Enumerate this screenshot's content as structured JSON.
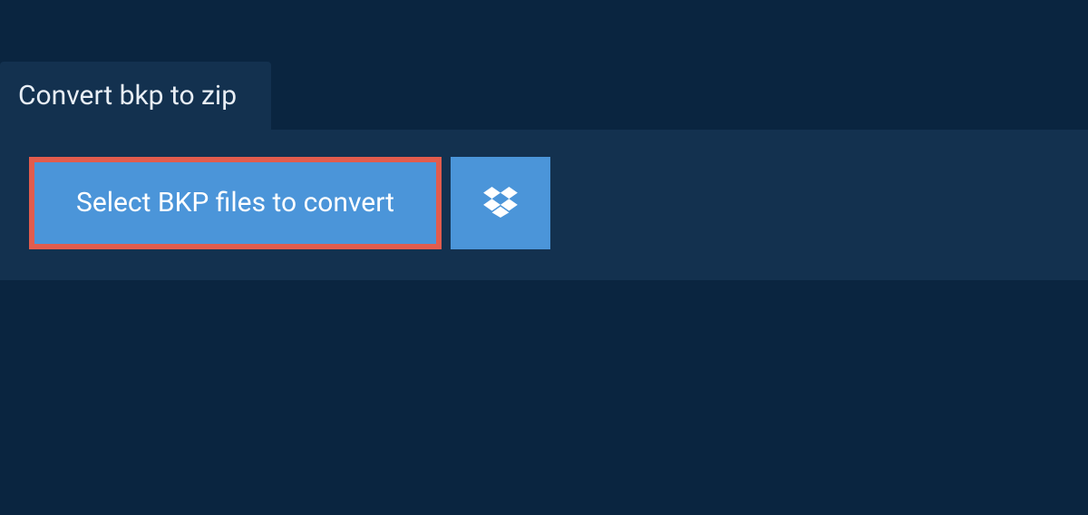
{
  "tab": {
    "label": "Convert bkp to zip"
  },
  "actions": {
    "select_files_label": "Select BKP files to convert"
  },
  "colors": {
    "background": "#0a2540",
    "panel": "#13314f",
    "button": "#4b95d9",
    "highlight_border": "#e25c4d",
    "text_light": "#ffffff"
  }
}
